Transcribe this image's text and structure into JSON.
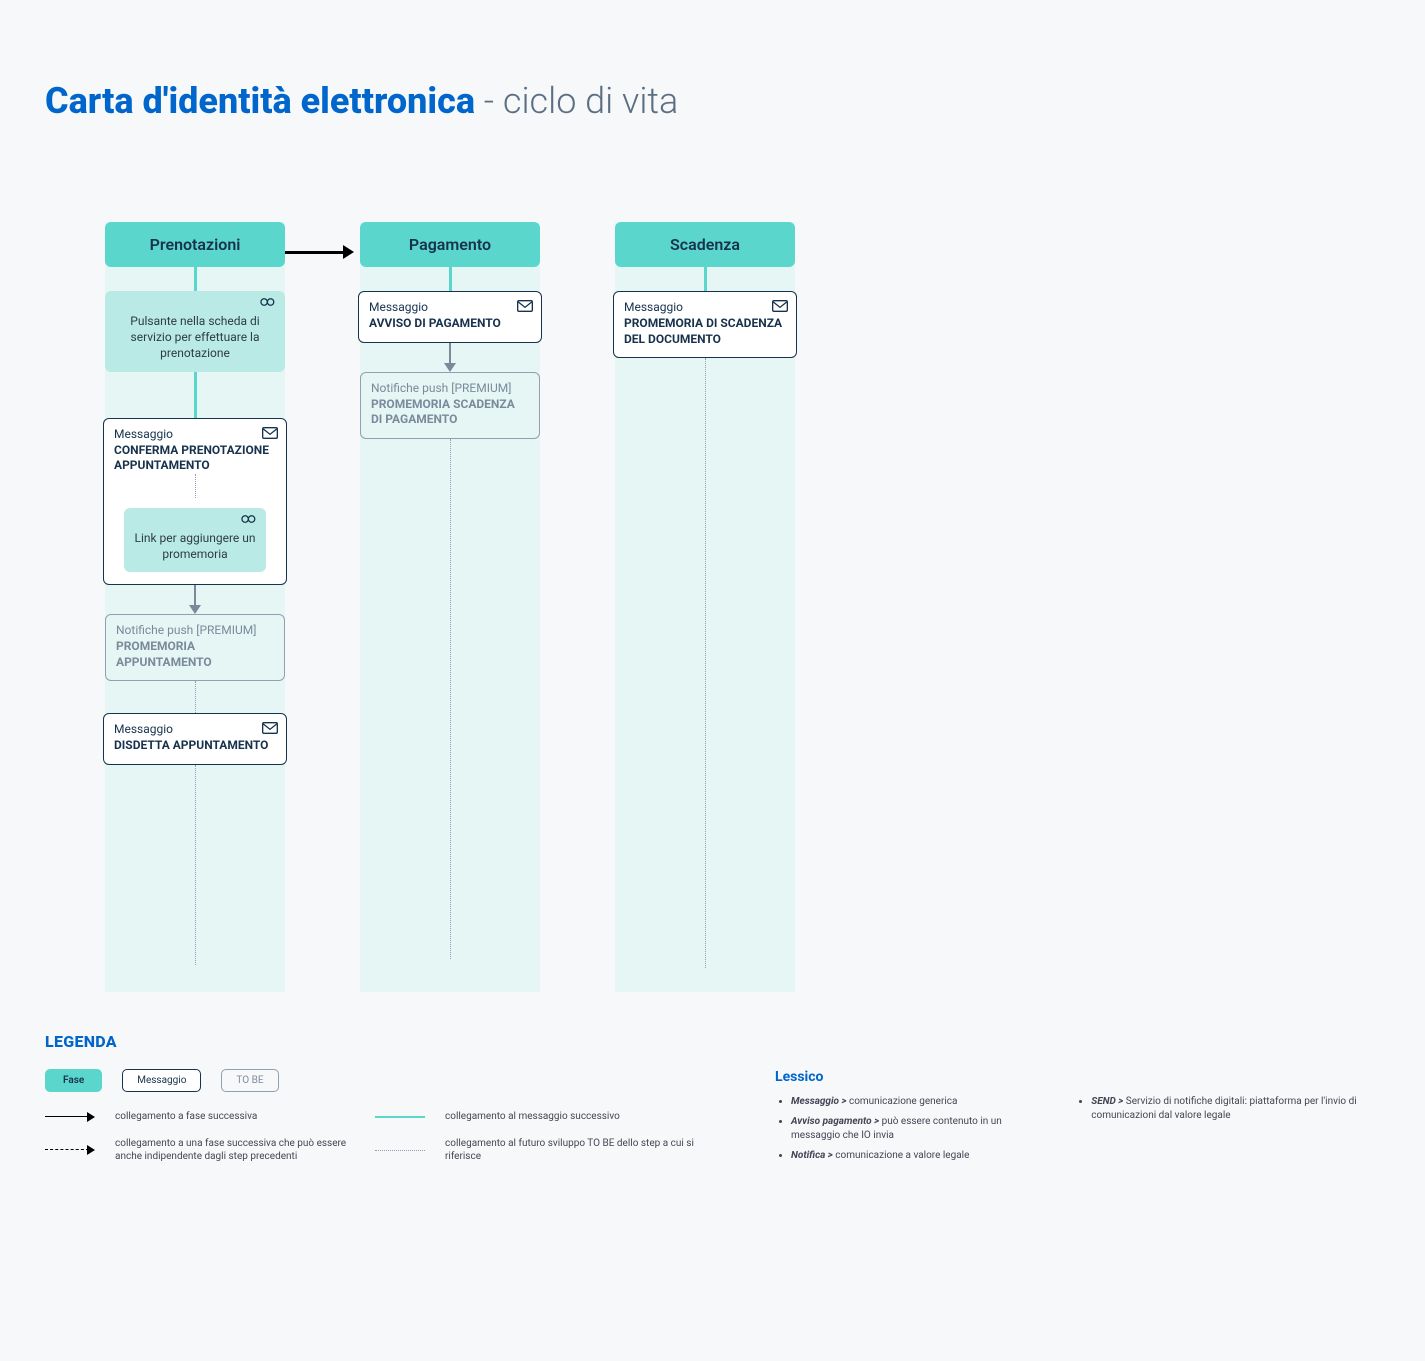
{
  "page": {
    "title_strong": "Carta d'identità elettronica",
    "title_light": " - ciclo di vita"
  },
  "phases": {
    "prenotazioni": {
      "header": "Prenotazioni",
      "action1": "Pulsante nella scheda di servizio per effettuare la prenotazione",
      "msg1_label": "Messaggio",
      "msg1_title": "CONFERMA PRENOTAZIONE APPUNTAMENTO",
      "nested_action": "Link per aggiungere un promemoria",
      "tobe_label": "Notifiche push [PREMIUM]",
      "tobe_title": "PROMEMORIA APPUNTAMENTO",
      "msg2_label": "Messaggio",
      "msg2_title": "DISDETTA APPUNTAMENTO"
    },
    "pagamento": {
      "header": "Pagamento",
      "msg1_label": "Messaggio",
      "msg1_title": "AVVISO DI PAGAMENTO",
      "tobe_label": "Notifiche push [PREMIUM]",
      "tobe_title": "PROMEMORIA SCADENZA DI PAGAMENTO"
    },
    "scadenza": {
      "header": "Scadenza",
      "msg1_label": "Messaggio",
      "msg1_title": "PROMEMORIA DI SCADENZA DEL DOCUMENTO"
    }
  },
  "legend": {
    "title": "LEGENDA",
    "chip_phase": "Fase",
    "chip_msg": "Messaggio",
    "chip_tobe": "TO BE",
    "arrow_solid": "collegamento a fase successiva",
    "arrow_dash": "collegamento a una fase successiva che può essere anche indipendente dagli step precedenti",
    "line_teal": "collegamento al messaggio successivo",
    "line_dotted": "collegamento al futuro sviluppo TO BE dello step a cui si riferisce"
  },
  "lessico": {
    "title": "Lessico",
    "items_left": [
      {
        "term": "Messaggio >",
        "def": " comunicazione generica"
      },
      {
        "term": "Avviso pagamento >",
        "def": " può essere contenuto in un messaggio che IO invia"
      },
      {
        "term": "Notifica >",
        "def": " comunicazione a valore legale"
      }
    ],
    "items_right": [
      {
        "term": "SEND >",
        "def": " Servizio di notifiche digitali:  piattaforma per  l'invio di comunicazioni dal valore legale"
      }
    ]
  }
}
